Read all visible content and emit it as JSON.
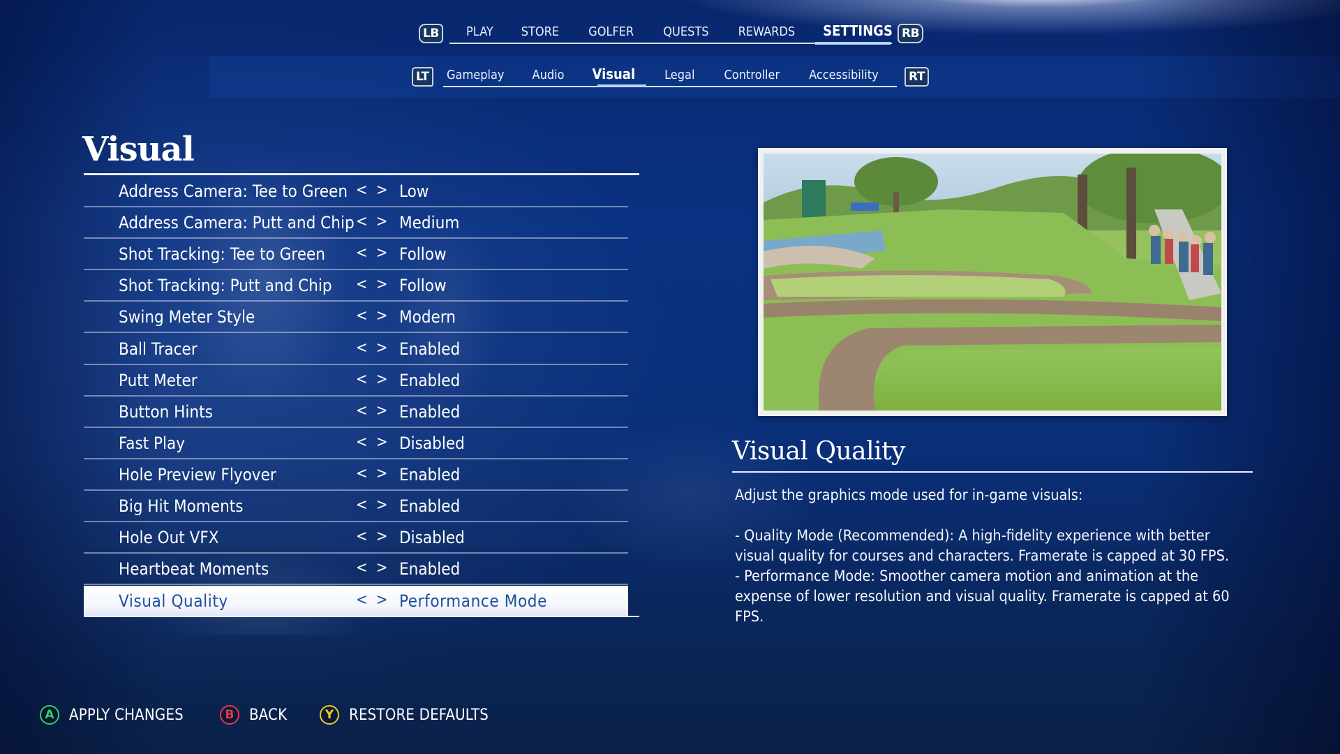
{
  "top_nav": {
    "left_bumper": "LB",
    "right_bumper": "RB",
    "tabs": [
      {
        "label": "PLAY",
        "active": false
      },
      {
        "label": "STORE",
        "active": false
      },
      {
        "label": "GOLFER",
        "active": false
      },
      {
        "label": "QUESTS",
        "active": false
      },
      {
        "label": "REWARDS",
        "active": false
      },
      {
        "label": "SETTINGS",
        "active": true
      }
    ]
  },
  "sub_nav": {
    "left_trigger": "LT",
    "right_trigger": "RT",
    "tabs": [
      {
        "label": "Gameplay",
        "active": false
      },
      {
        "label": "Audio",
        "active": false
      },
      {
        "label": "Visual",
        "active": true
      },
      {
        "label": "Legal",
        "active": false
      },
      {
        "label": "Controller",
        "active": false
      },
      {
        "label": "Accessibility",
        "active": false
      }
    ]
  },
  "section": {
    "title": "Visual",
    "arrows": "< >",
    "settings": [
      {
        "label": "Address Camera: Tee to Green",
        "value": "Low"
      },
      {
        "label": "Address Camera: Putt and Chip",
        "value": "Medium"
      },
      {
        "label": "Shot Tracking: Tee to Green",
        "value": "Follow"
      },
      {
        "label": "Shot Tracking: Putt and Chip",
        "value": "Follow"
      },
      {
        "label": "Swing Meter Style",
        "value": "Modern"
      },
      {
        "label": "Ball Tracer",
        "value": "Enabled"
      },
      {
        "label": "Putt Meter",
        "value": "Enabled"
      },
      {
        "label": "Button Hints",
        "value": "Enabled"
      },
      {
        "label": "Fast Play",
        "value": "Disabled"
      },
      {
        "label": "Hole Preview Flyover",
        "value": "Enabled"
      },
      {
        "label": "Big Hit Moments",
        "value": "Enabled"
      },
      {
        "label": "Hole Out VFX",
        "value": "Disabled"
      },
      {
        "label": "Heartbeat Moments",
        "value": "Enabled"
      },
      {
        "label": "Visual Quality",
        "value": "Performance Mode",
        "selected": true
      }
    ]
  },
  "detail": {
    "preview_image": "golf-course-preview",
    "title": "Visual Quality",
    "intro": "Adjust the graphics mode used for in-game visuals:",
    "quality_mode": "- Quality Mode (Recommended): A high-fidelity experience with better visual quality for courses and characters. Framerate is capped at 30 FPS.",
    "performance_mode": "- Performance Mode: Smoother camera motion and animation at the expense of lower resolution and visual quality. Framerate is capped at 60 FPS."
  },
  "hints": [
    {
      "button": "A",
      "label": "APPLY CHANGES",
      "color": "#2fd06a"
    },
    {
      "button": "B",
      "label": "BACK",
      "color": "#e8364a"
    },
    {
      "button": "Y",
      "label": "RESTORE DEFAULTS",
      "color": "#f2c81e"
    }
  ]
}
